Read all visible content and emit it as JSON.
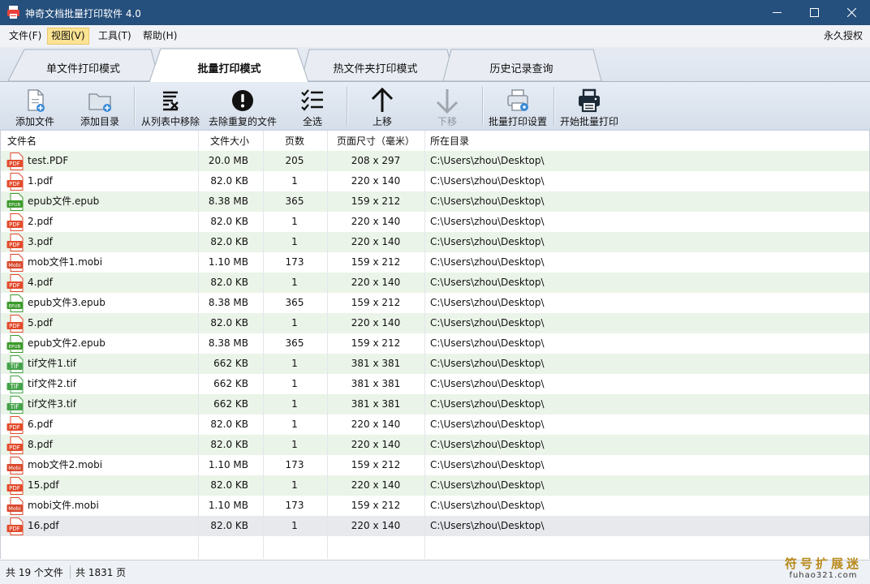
{
  "window": {
    "title": "神奇文档批量打印软件 4.0"
  },
  "menu": {
    "items": [
      "文件(F)",
      "视图(V)",
      "工具(T)",
      "帮助(H)"
    ],
    "active_index": 1,
    "license": "永久授权"
  },
  "tabs": {
    "items": [
      "单文件打印模式",
      "批量打印模式",
      "热文件夹打印模式",
      "历史记录查询"
    ],
    "active_index": 1
  },
  "toolbar": {
    "add_file": "添加文件",
    "add_folder": "添加目录",
    "remove": "从列表中移除",
    "dedupe": "去除重复的文件",
    "select_all": "全选",
    "move_up": "上移",
    "move_down": "下移",
    "print_settings": "批量打印设置",
    "start_print": "开始批量打印"
  },
  "table": {
    "columns": [
      "文件名",
      "文件大小",
      "页数",
      "页面尺寸（毫米）",
      "所在目录"
    ],
    "rows": [
      {
        "type": "PDF",
        "name": "test.PDF",
        "size": "20.0 MB",
        "pages": "205",
        "dim": "208 x 297",
        "dir": "C:\\Users\\zhou\\Desktop\\"
      },
      {
        "type": "PDF",
        "name": "1.pdf",
        "size": "82.0 KB",
        "pages": "1",
        "dim": "220 x 140",
        "dir": "C:\\Users\\zhou\\Desktop\\"
      },
      {
        "type": "EPUB",
        "name": "epub文件.epub",
        "size": "8.38 MB",
        "pages": "365",
        "dim": "159 x 212",
        "dir": "C:\\Users\\zhou\\Desktop\\"
      },
      {
        "type": "PDF",
        "name": "2.pdf",
        "size": "82.0 KB",
        "pages": "1",
        "dim": "220 x 140",
        "dir": "C:\\Users\\zhou\\Desktop\\"
      },
      {
        "type": "PDF",
        "name": "3.pdf",
        "size": "82.0 KB",
        "pages": "1",
        "dim": "220 x 140",
        "dir": "C:\\Users\\zhou\\Desktop\\"
      },
      {
        "type": "Mobi",
        "name": "mob文件1.mobi",
        "size": "1.10 MB",
        "pages": "173",
        "dim": "159 x 212",
        "dir": "C:\\Users\\zhou\\Desktop\\"
      },
      {
        "type": "PDF",
        "name": "4.pdf",
        "size": "82.0 KB",
        "pages": "1",
        "dim": "220 x 140",
        "dir": "C:\\Users\\zhou\\Desktop\\"
      },
      {
        "type": "EPUB",
        "name": "epub文件3.epub",
        "size": "8.38 MB",
        "pages": "365",
        "dim": "159 x 212",
        "dir": "C:\\Users\\zhou\\Desktop\\"
      },
      {
        "type": "PDF",
        "name": "5.pdf",
        "size": "82.0 KB",
        "pages": "1",
        "dim": "220 x 140",
        "dir": "C:\\Users\\zhou\\Desktop\\"
      },
      {
        "type": "EPUB",
        "name": "epub文件2.epub",
        "size": "8.38 MB",
        "pages": "365",
        "dim": "159 x 212",
        "dir": "C:\\Users\\zhou\\Desktop\\"
      },
      {
        "type": "TIF",
        "name": "tif文件1.tif",
        "size": "662 KB",
        "pages": "1",
        "dim": "381 x 381",
        "dir": "C:\\Users\\zhou\\Desktop\\"
      },
      {
        "type": "TIF",
        "name": "tif文件2.tif",
        "size": "662 KB",
        "pages": "1",
        "dim": "381 x 381",
        "dir": "C:\\Users\\zhou\\Desktop\\"
      },
      {
        "type": "TIF",
        "name": "tif文件3.tif",
        "size": "662 KB",
        "pages": "1",
        "dim": "381 x 381",
        "dir": "C:\\Users\\zhou\\Desktop\\"
      },
      {
        "type": "PDF",
        "name": "6.pdf",
        "size": "82.0 KB",
        "pages": "1",
        "dim": "220 x 140",
        "dir": "C:\\Users\\zhou\\Desktop\\"
      },
      {
        "type": "PDF",
        "name": "8.pdf",
        "size": "82.0 KB",
        "pages": "1",
        "dim": "220 x 140",
        "dir": "C:\\Users\\zhou\\Desktop\\"
      },
      {
        "type": "Mobi",
        "name": "mob文件2.mobi",
        "size": "1.10 MB",
        "pages": "173",
        "dim": "159 x 212",
        "dir": "C:\\Users\\zhou\\Desktop\\"
      },
      {
        "type": "PDF",
        "name": "15.pdf",
        "size": "82.0 KB",
        "pages": "1",
        "dim": "220 x 140",
        "dir": "C:\\Users\\zhou\\Desktop\\"
      },
      {
        "type": "Mobi",
        "name": "mobi文件.mobi",
        "size": "1.10 MB",
        "pages": "173",
        "dim": "159 x 212",
        "dir": "C:\\Users\\zhou\\Desktop\\"
      },
      {
        "type": "PDF",
        "name": "16.pdf",
        "size": "82.0 KB",
        "pages": "1",
        "dim": "220 x 140",
        "dir": "C:\\Users\\zhou\\Desktop\\",
        "selected": true
      }
    ]
  },
  "status": {
    "file_count": "共 19 个文件",
    "page_count": "共 1831 页"
  },
  "watermark": {
    "line1": "符号扩展迷",
    "line2": "fuhao321.com"
  },
  "colors": {
    "titlebar": "#254f7c",
    "row_alt": "#eaf4e8",
    "pdf": "#e24a2b",
    "epub": "#3c9a2b",
    "tif": "#45a34a",
    "mobi": "#d9472b"
  }
}
